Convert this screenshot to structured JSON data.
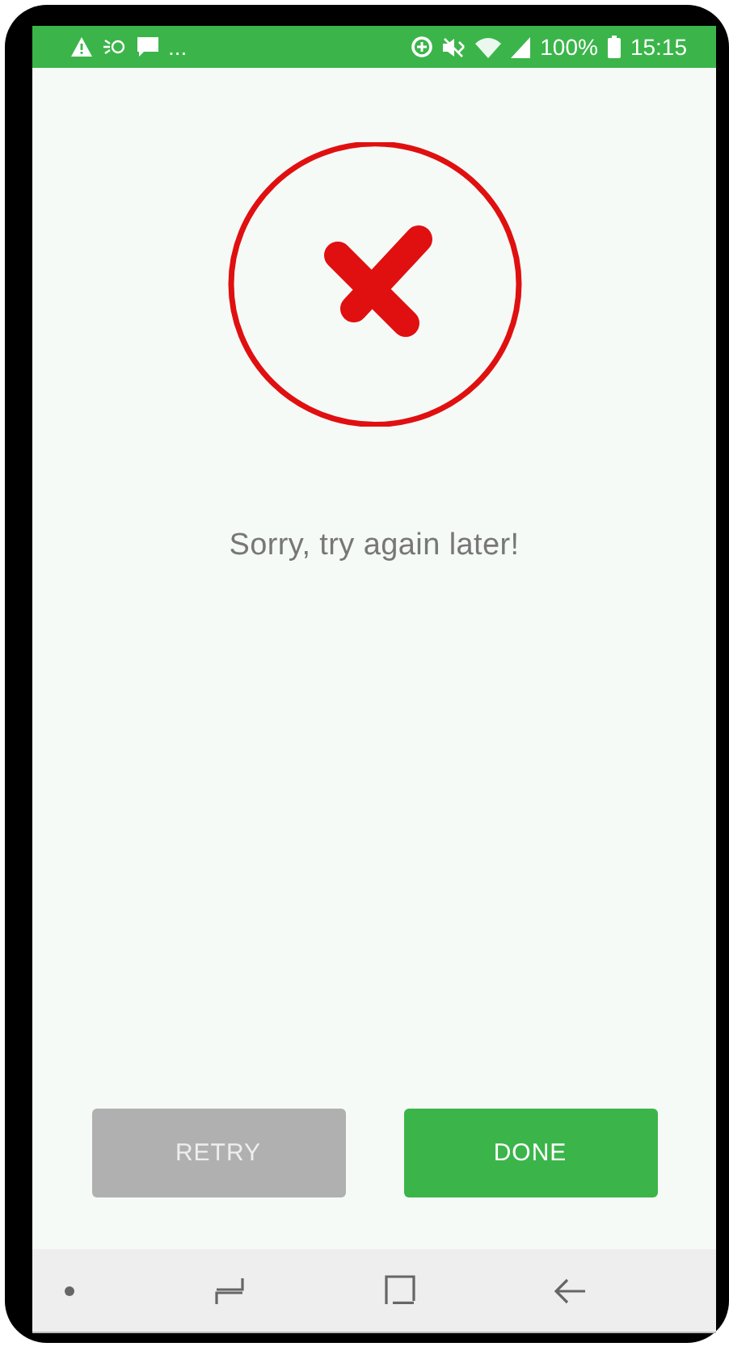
{
  "status_bar": {
    "notifications_more": "...",
    "battery": "100%",
    "time": "15:15"
  },
  "result": {
    "message": "Sorry, try again later!"
  },
  "buttons": [
    {
      "label": "RETRY",
      "kind": "secondary"
    },
    {
      "label": "DONE",
      "kind": "primary"
    }
  ]
}
